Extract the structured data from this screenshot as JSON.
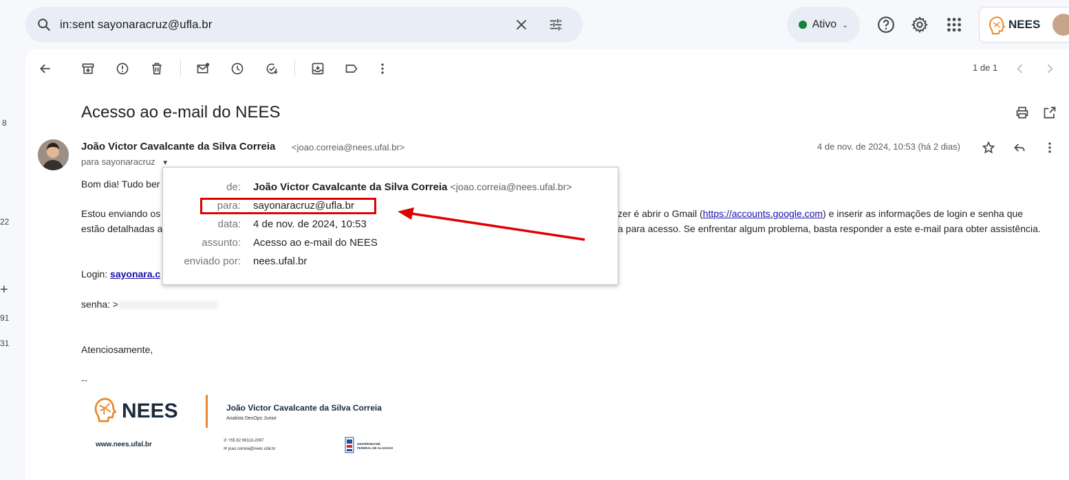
{
  "search": {
    "query": "in:sent sayonaracruz@ufla.br"
  },
  "status": {
    "label": "Ativo"
  },
  "left_rail": {
    "counts": [
      "8",
      "22",
      "91",
      "31"
    ]
  },
  "toolbar": {
    "pager": "1 de 1"
  },
  "email": {
    "subject": "Acesso ao e-mail do NEES",
    "sender_name": "João Victor Cavalcante da Silva Correia",
    "sender_email": "<joao.correia@nees.ufal.br>",
    "to": "para sayonaracruz",
    "date": "4 de nov. de 2024, 10:53 (há 2 dias)",
    "greeting": "Bom dia! Tudo ber",
    "para1_a": "Estou enviando os",
    "para1_b": "zer é abrir o Gmail (",
    "para1_link": "https://accounts.google.com",
    "para1_c": ") e inserir as informações de login e senha que",
    "para2_a": "estão detalhadas a",
    "para2_b": "a para acesso. Se enfrentar algum problema, basta responder a este e-mail para obter assistência.",
    "login_label": "Login: ",
    "login_value": "sayonara.c",
    "senha_label": "senha: >",
    "closing": "Atenciosamente,",
    "sig_sep": "--"
  },
  "details": {
    "de_label": "de:",
    "de_name": "João Victor Cavalcante da Silva Correia",
    "de_email": "<joao.correia@nees.ufal.br>",
    "para_label": "para:",
    "para_value": "sayonaracruz@ufla.br",
    "data_label": "data:",
    "data_value": "4 de nov. de 2024, 10:53",
    "assunto_label": "assunto:",
    "assunto_value": "Acesso ao e-mail do NEES",
    "enviado_label": "enviado por:",
    "enviado_value": "nees.ufal.br"
  },
  "signature": {
    "logo_text": "NEES",
    "name": "João Victor Cavalcante da Silva Correia",
    "role": "Analista DevOps Junior",
    "website": "www.nees.ufal.br",
    "phone": "+55 82 99113-2097",
    "email": "joao.correia@nees.ufal.br",
    "uni_line1": "UNIVERSIDADE",
    "uni_line2": "FEDERAL DE ALAGOAS"
  },
  "colors": {
    "accent_orange": "#e8872b",
    "highlight_red": "#e00000",
    "link_blue": "#1a0dab"
  }
}
